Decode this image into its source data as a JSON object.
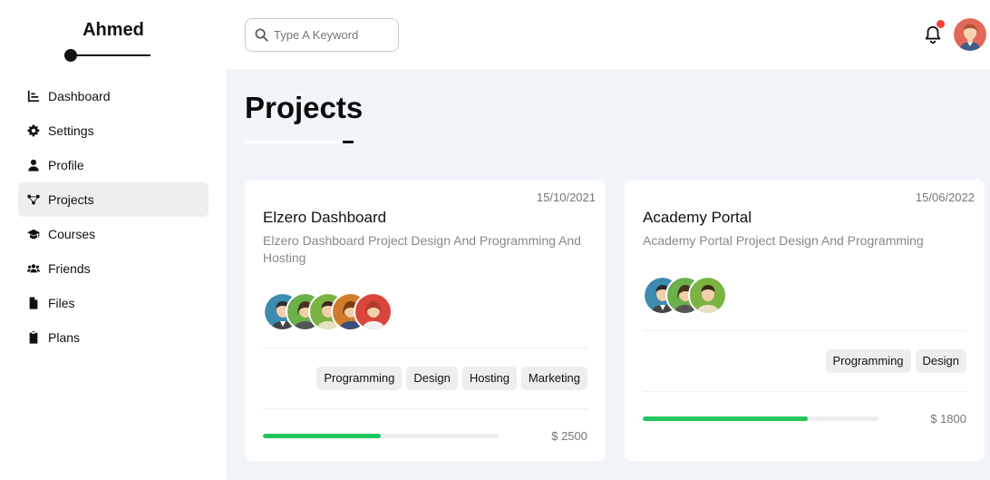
{
  "sidebar": {
    "brand": "Ahmed",
    "items": [
      {
        "label": "Dashboard",
        "icon": "chart-icon"
      },
      {
        "label": "Settings",
        "icon": "gear-icon"
      },
      {
        "label": "Profile",
        "icon": "user-icon"
      },
      {
        "label": "Projects",
        "icon": "diagram-icon",
        "active": true
      },
      {
        "label": "Courses",
        "icon": "graduation-cap-icon"
      },
      {
        "label": "Friends",
        "icon": "users-icon"
      },
      {
        "label": "Files",
        "icon": "file-icon"
      },
      {
        "label": "Plans",
        "icon": "clipboard-icon"
      }
    ]
  },
  "header": {
    "search_placeholder": "Type A Keyword",
    "search_value": "",
    "notification_dot_color": "#f44336"
  },
  "main": {
    "title": "Projects",
    "projects": [
      {
        "date": "15/10/2021",
        "title": "Elzero Dashboard",
        "description": "Elzero Dashboard Project Design And Programming And Hosting",
        "team_count": 5,
        "tags": [
          "Programming",
          "Design",
          "Hosting",
          "Marketing"
        ],
        "progress": 0.5,
        "price": "$ 2500"
      },
      {
        "date": "15/06/2022",
        "title": "Academy Portal",
        "description": "Academy Portal Project Design And Programming",
        "team_count": 3,
        "tags": [
          "Programming",
          "Design"
        ],
        "progress": 0.7,
        "price": "$ 1800"
      }
    ]
  },
  "colors": {
    "accent_green": "#22c55e",
    "background": "#f1f5f9",
    "active_nav": "#eceeef"
  }
}
